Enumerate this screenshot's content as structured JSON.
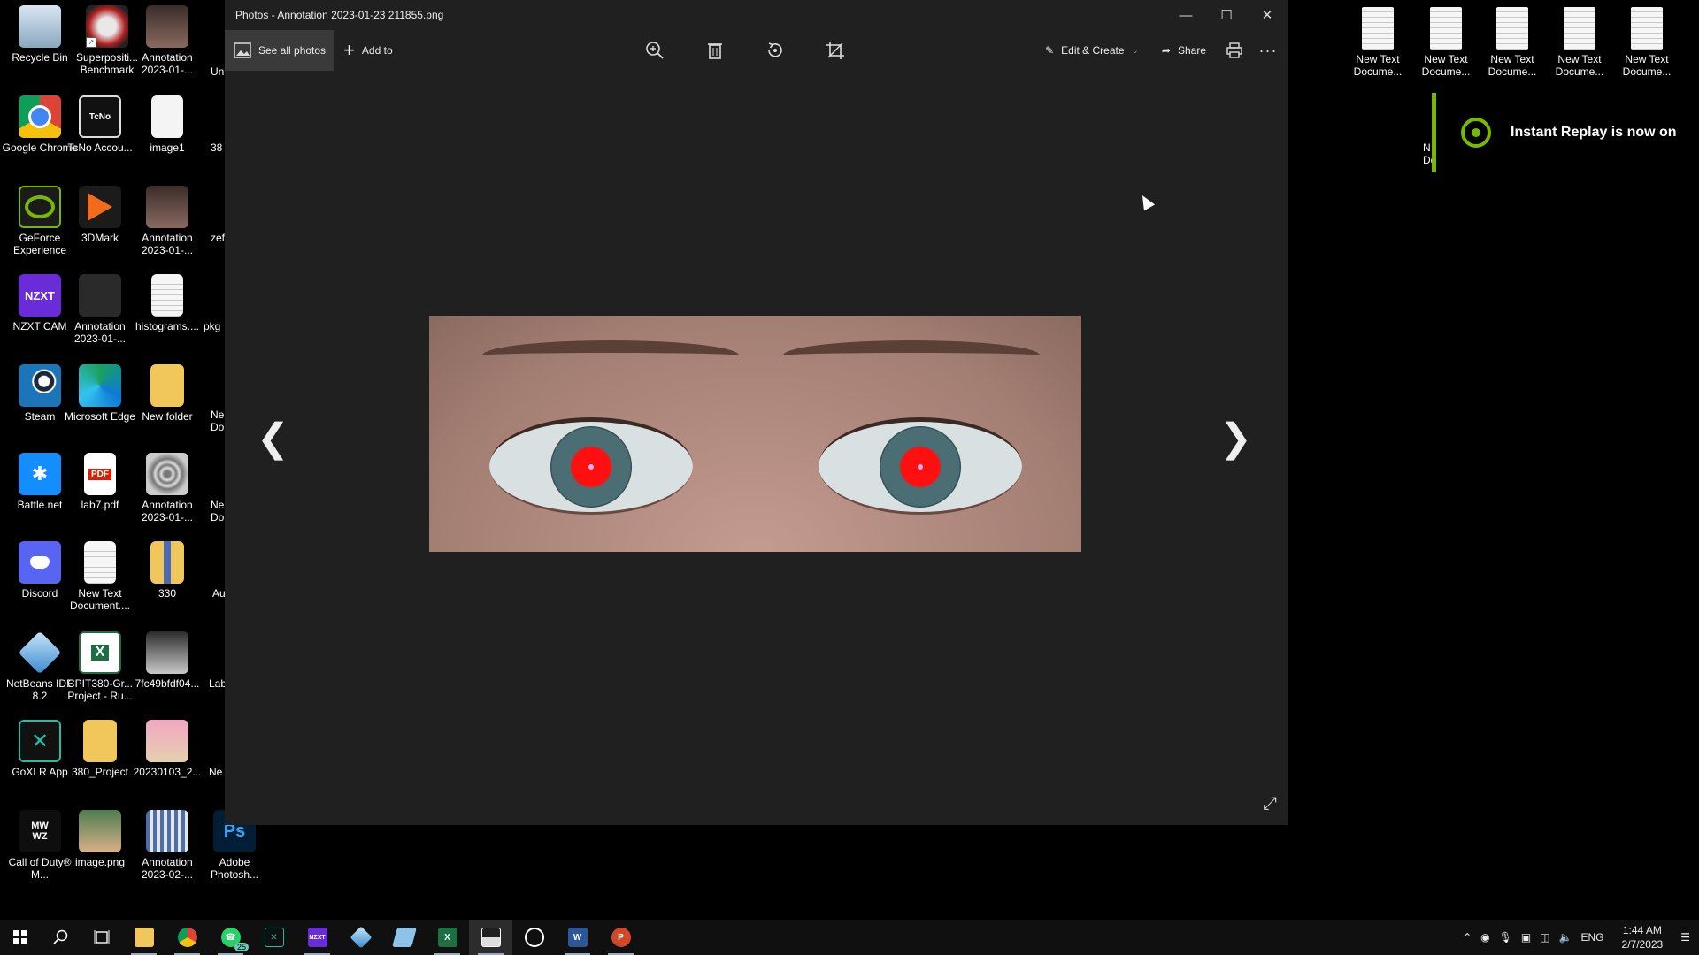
{
  "desktop": {
    "icons": [
      {
        "label": "Recycle Bin",
        "icon": "recycle-bin-icon"
      },
      {
        "label": "Superpositi... Benchmark",
        "icon": "superposition-benchmark-icon"
      },
      {
        "label": "Annotation 2023-01-...",
        "icon": "image-thumbnail-icon"
      },
      {
        "label": "Google Chrome",
        "icon": "chrome-icon"
      },
      {
        "label": "TcNo Accou...",
        "icon": "tcno-account-switcher-icon"
      },
      {
        "label": "image1",
        "icon": "document-icon"
      },
      {
        "label": "GeForce Experience",
        "icon": "geforce-experience-icon"
      },
      {
        "label": "3DMark",
        "icon": "3dmark-icon"
      },
      {
        "label": "Annotation 2023-01-...",
        "icon": "image-thumbnail-icon"
      },
      {
        "label": "NZXT CAM",
        "icon": "nzxt-cam-icon"
      },
      {
        "label": "Annotation 2023-01-...",
        "icon": "image-thumbnail-icon"
      },
      {
        "label": "histograms....",
        "icon": "text-document-icon"
      },
      {
        "label": "Steam",
        "icon": "steam-icon"
      },
      {
        "label": "Microsoft Edge",
        "icon": "edge-icon"
      },
      {
        "label": "New folder",
        "icon": "folder-icon"
      },
      {
        "label": "Battle.net",
        "icon": "battlenet-icon"
      },
      {
        "label": "lab7.pdf",
        "icon": "pdf-icon"
      },
      {
        "label": "Annotation 2023-01-...",
        "icon": "image-thumbnail-icon"
      },
      {
        "label": "Discord",
        "icon": "discord-icon"
      },
      {
        "label": "New Text Document....",
        "icon": "text-document-icon"
      },
      {
        "label": "330",
        "icon": "zip-folder-icon"
      },
      {
        "label": "NetBeans IDE 8.2",
        "icon": "netbeans-icon"
      },
      {
        "label": "CPIT380-Gr... Project - Ru...",
        "icon": "excel-file-icon"
      },
      {
        "label": "7fc49bfdf04...",
        "icon": "image-thumbnail-icon"
      },
      {
        "label": "GoXLR App",
        "icon": "goxlr-icon"
      },
      {
        "label": "380_Project",
        "icon": "folder-icon"
      },
      {
        "label": "20230103_2...",
        "icon": "image-thumbnail-icon"
      },
      {
        "label": "Call of Duty® M...",
        "icon": "call-of-duty-icon"
      },
      {
        "label": "image.png",
        "icon": "image-thumbnail-icon"
      },
      {
        "label": "Annotation 2023-02-...",
        "icon": "image-thumbnail-icon"
      },
      {
        "label": "Adobe Photosh...",
        "icon": "photoshop-icon"
      }
    ],
    "partial_labels": [
      "Un",
      "38",
      "zef",
      "pkg",
      "Ne Do",
      "Ne Do",
      "Au",
      "Lab",
      "Ne"
    ],
    "right_files": [
      {
        "label": "New Text Docume..."
      },
      {
        "label": "New Text Docume..."
      },
      {
        "label": "New Text Docume..."
      },
      {
        "label": "New Text Docume..."
      },
      {
        "label": "New Text Docume..."
      }
    ],
    "right_partial": "N Do"
  },
  "photos": {
    "title": "Photos - Annotation 2023-01-23 211855.png",
    "toolbar": {
      "see_all": "See all photos",
      "add_to": "Add to",
      "edit_create": "Edit & Create",
      "share": "Share"
    },
    "icons": [
      "zoom-in-icon",
      "delete-icon",
      "rotate-icon",
      "crop-icon",
      "print-icon",
      "more-icon"
    ]
  },
  "toast": {
    "text": "Instant Replay is now on"
  },
  "taskbar": {
    "whatsapp_badge": "25",
    "lang": "ENG",
    "time": "1:44 AM",
    "date": "2/7/2023"
  },
  "colors": {
    "window_bg": "#202020",
    "nvidia_green": "#76b900",
    "taskbar_bg": "#101010"
  }
}
